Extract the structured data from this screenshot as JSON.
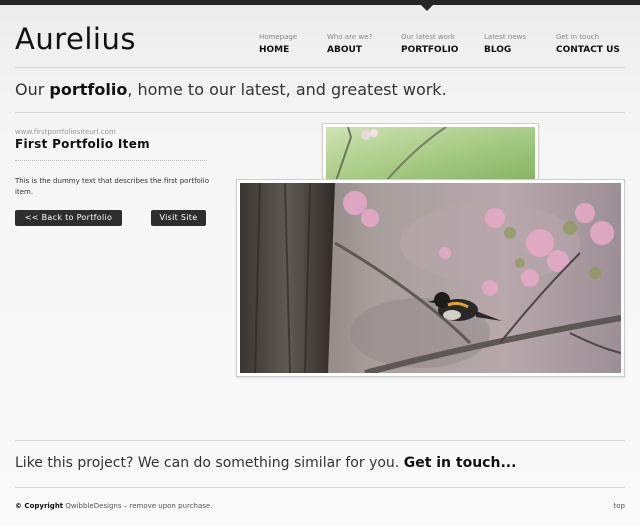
{
  "brand": {
    "logo": "Aurelius"
  },
  "nav": [
    {
      "sub": "Homepage",
      "label": "HOME"
    },
    {
      "sub": "Who are we?",
      "label": "ABOUT"
    },
    {
      "sub": "Our latest work",
      "label": "PORTFOLIO"
    },
    {
      "sub": "Latest news",
      "label": "BLOG"
    },
    {
      "sub": "Get in touch",
      "label": "CONTACT US"
    }
  ],
  "tagline": {
    "pre": "Our ",
    "bold": "portfolio",
    "post": ", home to our latest, and greatest work."
  },
  "item": {
    "url": "www.firstportfoliositeurl.com",
    "title": "First Portfolio Item",
    "description": "This is the dummy text that describes the first portfolio item.",
    "back_label": "<< Back to Portfolio",
    "visit_label": "Visit Site"
  },
  "cta": {
    "text": "Like this project? We can do something similar for you. ",
    "link": "Get in touch..."
  },
  "footer": {
    "copyright_bold": "© Copyright",
    "copyright_rest": " QwibbleDesigns – remove upon purchase.",
    "top_link": "top"
  },
  "colors": {
    "topbar": "#252525",
    "button": "#2e2e2e",
    "rule": "#d6d6d6"
  }
}
